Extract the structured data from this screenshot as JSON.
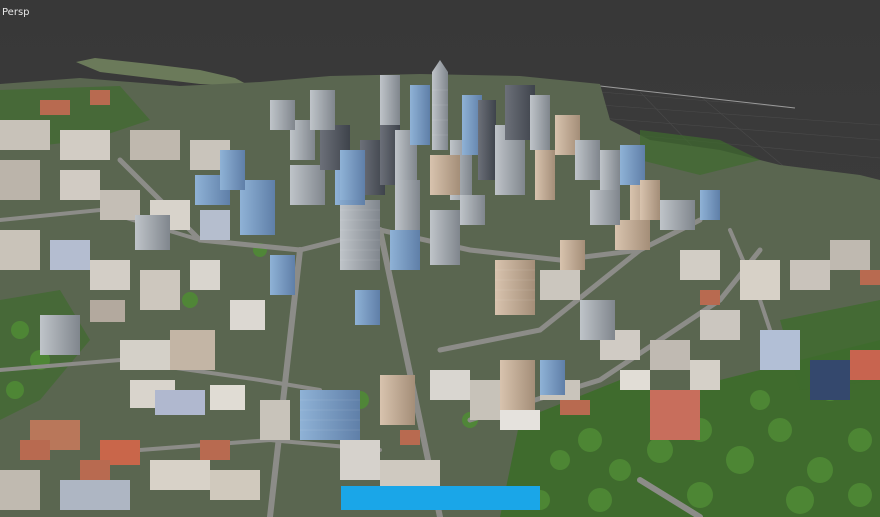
{
  "viewport": {
    "view_label": "Persp",
    "background_color": "#3b3b3b"
  },
  "scene": {
    "description_icon": "city-3d-model",
    "ground_color": "#5c6b4a",
    "tree_color": "#3e6e2c",
    "road_color": "#8a8a86"
  },
  "overlay": {
    "progress_bar_color": "#1aa6e8"
  }
}
